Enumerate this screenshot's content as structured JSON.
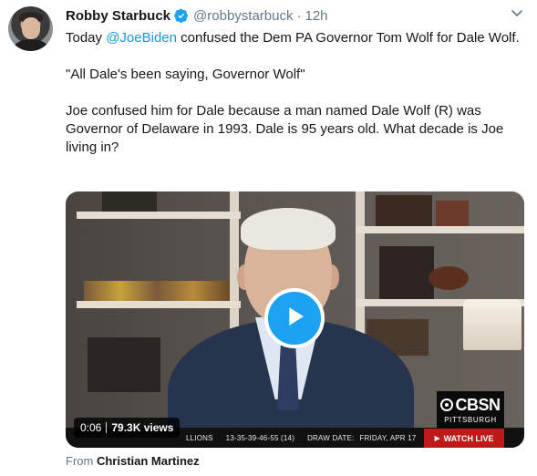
{
  "tweet": {
    "author_name": "Robby Starbuck",
    "author_handle": "@robbystarbuck",
    "separator": "·",
    "time": "12h",
    "text_parts": {
      "p1": "Today ",
      "mention": "@JoeBiden",
      "p2": " confused the Dem PA Governor Tom Wolf for Dale Wolf.\n\n\"All Dale's been saying, Governor Wolf\"\n\nJoe confused him for Dale because a man named Dale Wolf (R) was Governor of Delaware in 1993. Dale is 95 years old. What decade is Joe living in?"
    },
    "video": {
      "duration": "0:06",
      "views": "79.3K views",
      "ticker_left": "LLIONS",
      "ticker_mid": "13-35-39-46-55 (14)",
      "ticker_draw": "DRAW DATE:",
      "ticker_date": "FRIDAY, APR 17",
      "network": "CBSN",
      "network_sub": "PITTSBURGH",
      "watch": "WATCH",
      "live": "LIVE"
    },
    "from_label": "From",
    "from_source": "Christian Martinez"
  },
  "colors": {
    "link": "#1b95e0",
    "play": "#1da1f2",
    "watch_live": "#bf1a1a"
  },
  "icons": [
    "verified-badge-icon",
    "chevron-down-icon",
    "play-icon"
  ]
}
